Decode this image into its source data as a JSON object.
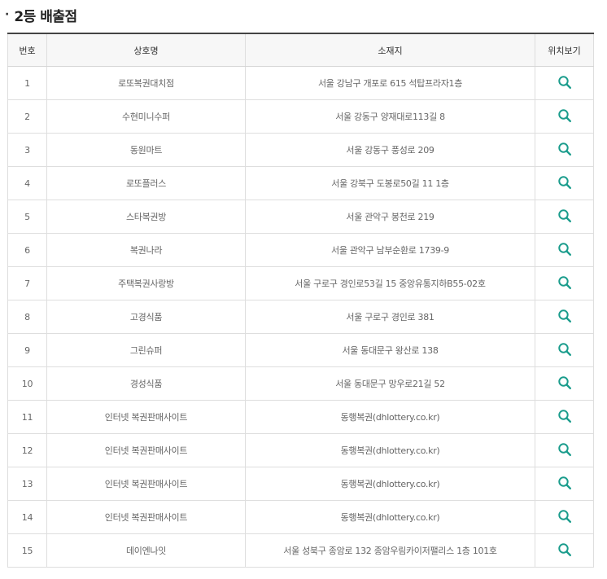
{
  "heading": {
    "bullet": "·",
    "title": "2등 배출점"
  },
  "table": {
    "headers": {
      "no": "번호",
      "name": "상호명",
      "address": "소재지",
      "location": "위치보기"
    },
    "rows": [
      {
        "no": "1",
        "name": "로또복권대치점",
        "address": "서울 강남구 개포로 615 석탑프라자1층"
      },
      {
        "no": "2",
        "name": "수현미니수퍼",
        "address": "서울 강동구 양재대로113길 8"
      },
      {
        "no": "3",
        "name": "동원마트",
        "address": "서울 강동구 풍성로 209"
      },
      {
        "no": "4",
        "name": "로또플러스",
        "address": "서울 강북구 도봉로50길 11 1층"
      },
      {
        "no": "5",
        "name": "스타복권방",
        "address": "서울 관악구 봉천로 219"
      },
      {
        "no": "6",
        "name": "복권나라",
        "address": "서울 관악구 남부순환로 1739-9"
      },
      {
        "no": "7",
        "name": "주택복권사랑방",
        "address": "서울 구로구 경인로53길 15 중앙유통지하B55-02호"
      },
      {
        "no": "8",
        "name": "고경식품",
        "address": "서울 구로구 경인로 381"
      },
      {
        "no": "9",
        "name": "그린슈퍼",
        "address": "서울 동대문구 왕산로 138"
      },
      {
        "no": "10",
        "name": "경성식품",
        "address": "서울 동대문구 망우로21길 52"
      },
      {
        "no": "11",
        "name": "인터넷 복권판매사이트",
        "address": "동행복권(dhlottery.co.kr)"
      },
      {
        "no": "12",
        "name": "인터넷 복권판매사이트",
        "address": "동행복권(dhlottery.co.kr)"
      },
      {
        "no": "13",
        "name": "인터넷 복권판매사이트",
        "address": "동행복권(dhlottery.co.kr)"
      },
      {
        "no": "14",
        "name": "인터넷 복권판매사이트",
        "address": "동행복권(dhlottery.co.kr)"
      },
      {
        "no": "15",
        "name": "데이엔나잇",
        "address": "서울 성북구 종암로 132 종암우림카이저팰리스 1층 101호"
      }
    ]
  },
  "icons": {
    "location": "search-icon"
  },
  "colors": {
    "icon": "#1a9c8c",
    "header_border": "#444444"
  }
}
